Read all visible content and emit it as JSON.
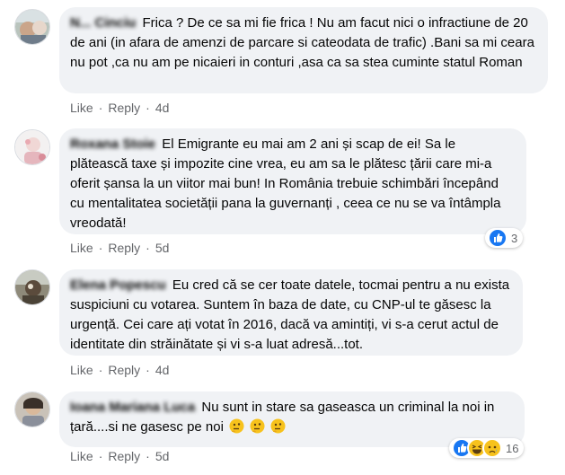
{
  "like_label": "Like",
  "reply_label": "Reply",
  "separator": "·",
  "comments": [
    {
      "author": "N... Cinciu",
      "text": "Frica ? De ce sa mi fie frica ! Nu am facut nici o infractiune de 20 de ani (in afara de amenzi de parcare si cateodata de trafic) .Bani sa mi ceara nu pot ,ca nu am pe nicaieri in conturi ,asa ca sa stea cuminte statul Roman",
      "age": "4d"
    },
    {
      "author": "Roxana Stoie",
      "text": "El Emigrante eu mai am 2 ani și scap de ei! Sa le plătească taxe și impozite cine vrea, eu am sa le plătesc țării care mi-a oferit șansa la un viitor mai bun! In România trebuie schimbări începând cu mentalitatea societății pana la guvernanți , ceea ce nu se va întâmpla vreodată!",
      "age": "5d",
      "reaction_count": "3",
      "reactions": [
        "like"
      ]
    },
    {
      "author": "Elena Popescu",
      "text": "Eu cred că se cer toate datele, tocmai pentru a nu exista suspiciuni cu votarea. Suntem în baza de date, cu CNP-ul te găsesc la urgență. Cei care ați votat în 2016, dacă va amintiți, vi s-a cerut actul de identitate din străinătate și vi s-a luat adresă...tot.",
      "age": "4d"
    },
    {
      "author": "Ioana Mariana Luca",
      "text": "Nu sunt in stare sa gaseasca un criminal la noi in țară....si ne gasesc pe noi",
      "emoji_count": 3,
      "age": "5d",
      "reaction_count": "16",
      "reactions": [
        "like",
        "haha",
        "sad"
      ]
    }
  ],
  "colors": {
    "bubble": "#f0f2f5",
    "meta_text": "#65676b",
    "like_blue": "#1877f2",
    "emoji_yellow": "#f7c21c"
  }
}
